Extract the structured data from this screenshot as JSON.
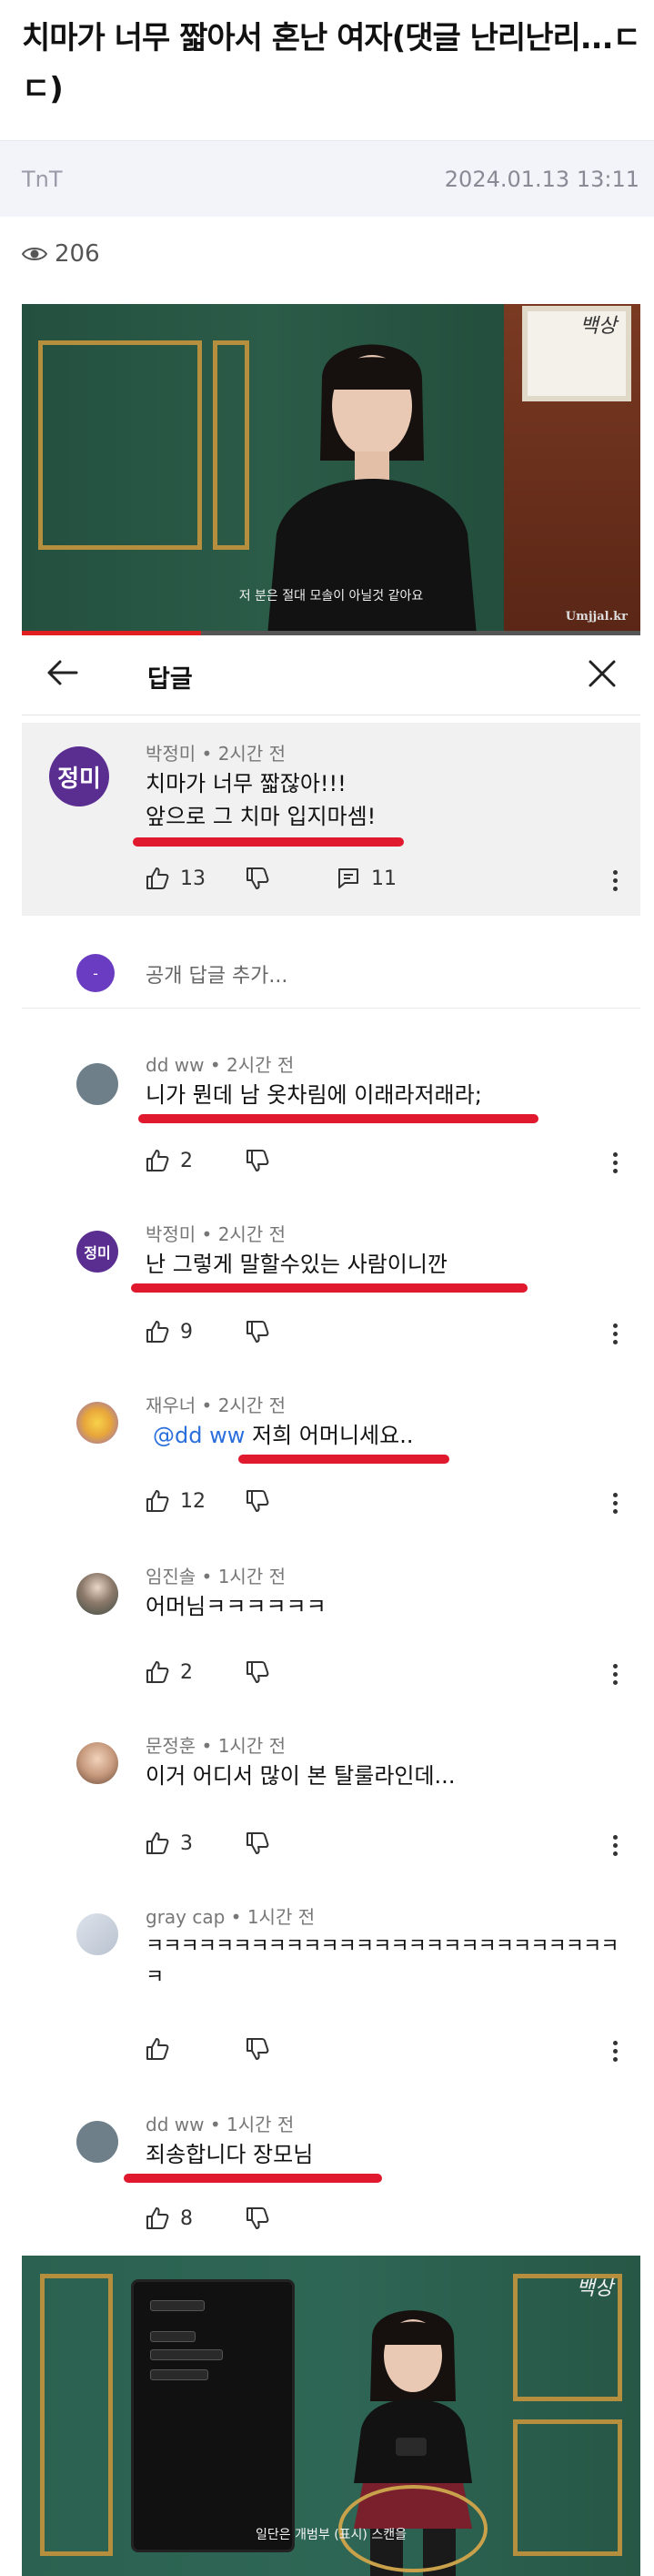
{
  "article": {
    "title": "치마가 너무 짧아서 혼난 여자(댓글 난리난리...ㄷㄷ)",
    "author": "TnT",
    "date": "2024.01.13 13:11",
    "views": "206"
  },
  "video_top": {
    "subtitle": "저 분은 절대 모솔이 아닐것 같아요",
    "watermark": "Umjjal.kr",
    "brand": "백상",
    "progress_fraction": 0.29
  },
  "replies_panel": {
    "title": "답글",
    "back_icon": "arrow-left-icon",
    "close_icon": "close-icon",
    "parent": {
      "avatar_text": "정미",
      "author": "박정미 • 2시간 전",
      "line1": "치마가 너무 짧잖아!!!",
      "line2": "앞으로 그 치마 입지마셈!",
      "likes": "13",
      "replies": "11"
    },
    "add_reply": {
      "avatar_text": "-",
      "placeholder": "공개 답글 추가..."
    },
    "comments": [
      {
        "author": "dd ww • 2시간 전",
        "text": "니가 뭔데 남 옷차림에 이래라저래라;",
        "likes": "2",
        "avatar_color": "#6e7f8a"
      },
      {
        "author": "박정미 • 2시간 전",
        "text": "난 그렇게 말할수있는 사람이니깐",
        "likes": "9",
        "avatar_text": "정미",
        "avatar_color": "#5a2d91"
      },
      {
        "author": "재우너 • 2시간 전",
        "mention": "@dd ww",
        "text": "저희 어머니세요..",
        "likes": "12",
        "avatar_color": "#e8a63a"
      },
      {
        "author": "임진솔 • 1시간 전",
        "text": "어머님ㅋㅋㅋㅋㅋㅋ",
        "likes": "2",
        "avatar_color": "#4d5b52"
      },
      {
        "author": "문정훈 • 1시간 전",
        "text": "이거 어디서 많이 본 탈룰라인데...",
        "likes": "3",
        "avatar_color": "#c79a7d"
      },
      {
        "author": "gray cap • 1시간 전",
        "text": "ㅋㅋㅋㅋㅋㅋㅋㅋㅋㅋㅋㅋㅋㅋㅋㅋㅋㅋㅋㅋㅋㅋㅋㅋㅋㅋㅋㅋ",
        "likes": "",
        "avatar_color": "#b9c2cf"
      },
      {
        "author": "dd ww • 1시간 전",
        "text": "죄송합니다 장모님",
        "likes": "8",
        "avatar_color": "#6e7f8a"
      }
    ]
  },
  "video_bottom": {
    "subtitle": "일단은 개범부 (표시) 스캔을",
    "brand": "백상"
  },
  "colors": {
    "underline": "#e0192e",
    "mention": "#2a6fdb",
    "parent_bg": "#f1f1f1",
    "meta_bg": "#f3f4f9"
  }
}
